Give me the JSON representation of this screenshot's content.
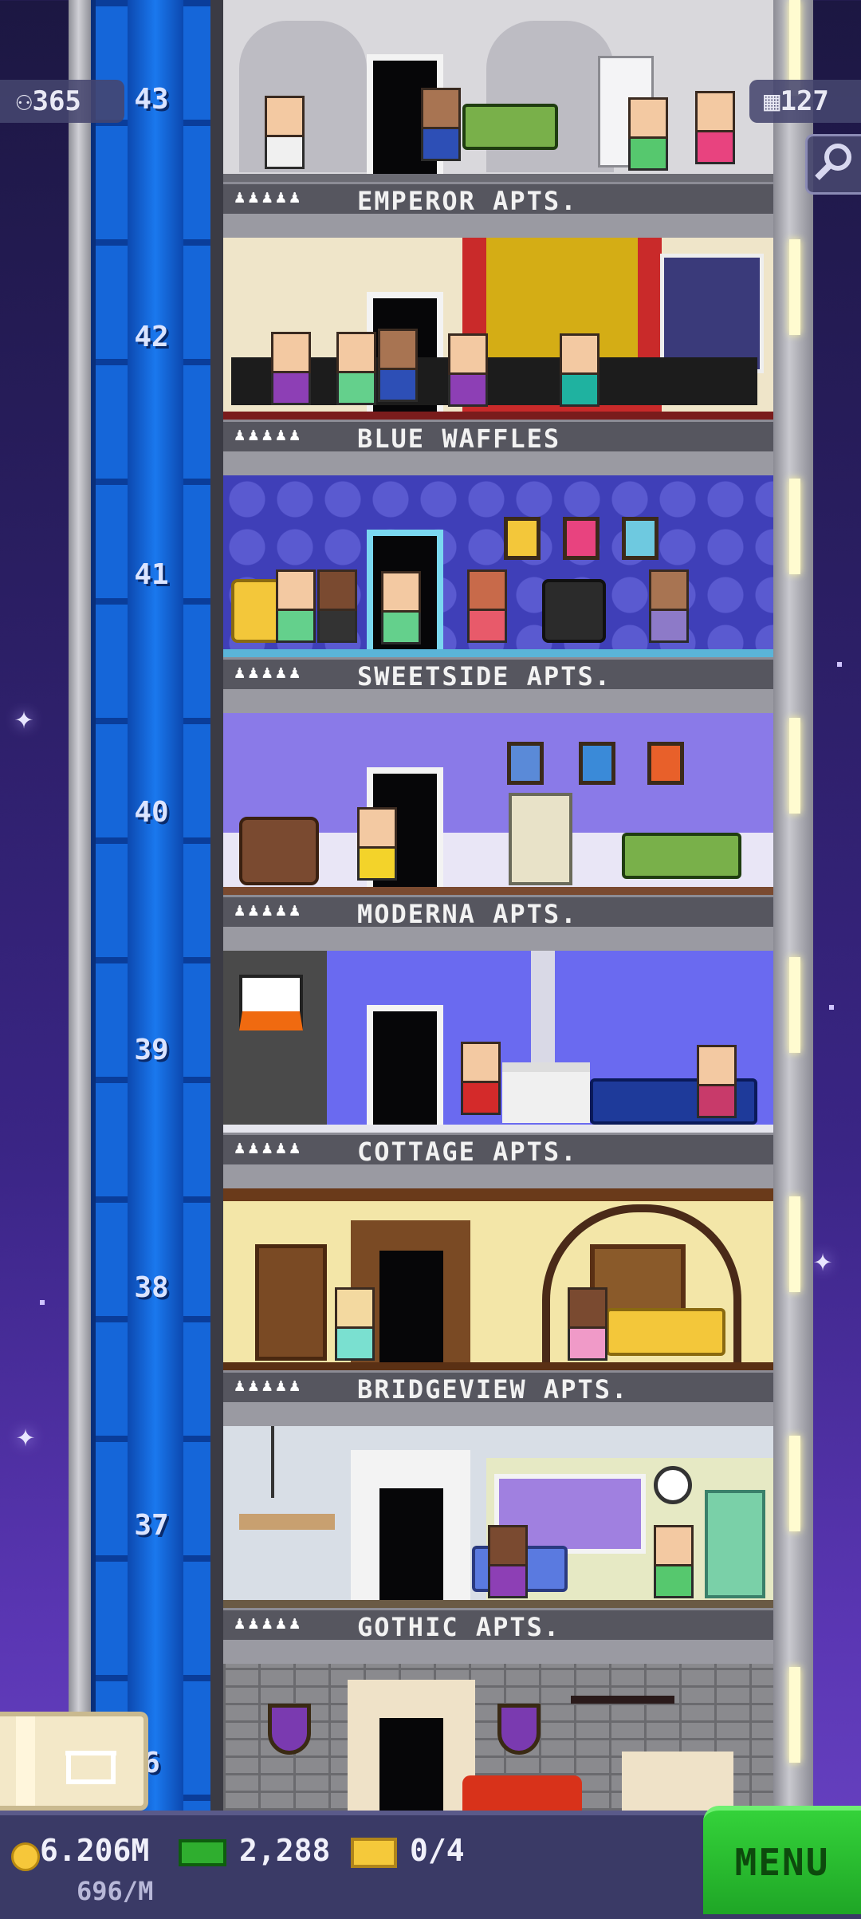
{
  "hud": {
    "population": "365",
    "floors_count": "127",
    "coins": "6.206M",
    "coin_rate": "696/M",
    "bux": "2,288",
    "vip": "0/4",
    "menu_label": "MENU"
  },
  "floors": [
    {
      "number": "43",
      "name": "EMPEROR APTS."
    },
    {
      "number": "42",
      "name": "BLUE WAFFLES"
    },
    {
      "number": "41",
      "name": "SWEETSIDE APTS."
    },
    {
      "number": "40",
      "name": "MODERNA APTS."
    },
    {
      "number": "39",
      "name": "COTTAGE APTS."
    },
    {
      "number": "38",
      "name": "BRIDGEVIEW APTS."
    },
    {
      "number": "37",
      "name": "GOTHIC APTS."
    },
    {
      "number": "36",
      "name": ""
    }
  ],
  "rating_stars": "♟♟♟♟♟",
  "colors": {
    "elevator": "#1566d9",
    "menu_button": "#2bc231",
    "hud_bar": "#3a3a66"
  },
  "icons": [
    "person-icon",
    "floors-grid-icon",
    "search-icon",
    "coin-icon",
    "bux-icon",
    "vip-ticket-icon",
    "storage-box-icon"
  ]
}
